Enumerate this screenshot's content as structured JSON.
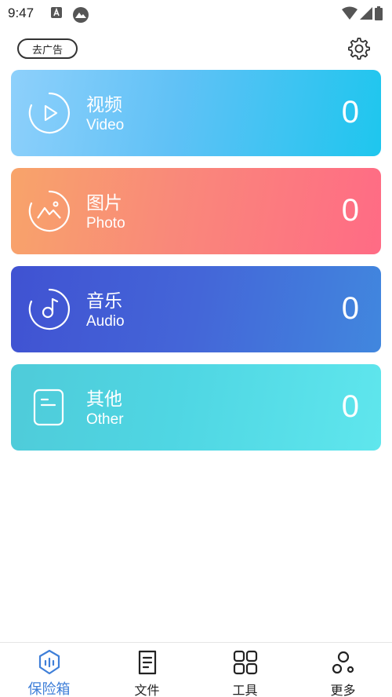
{
  "status_bar": {
    "time": "9:47"
  },
  "header": {
    "ad_button_label": "去广告"
  },
  "categories": [
    {
      "title": "视频",
      "subtitle": "Video",
      "count": "0"
    },
    {
      "title": "图片",
      "subtitle": "Photo",
      "count": "0"
    },
    {
      "title": "音乐",
      "subtitle": "Audio",
      "count": "0"
    },
    {
      "title": "其他",
      "subtitle": "Other",
      "count": "0"
    }
  ],
  "bottom_nav": {
    "items": [
      {
        "label": "保险箱",
        "icon": "vault-icon",
        "active": true
      },
      {
        "label": "文件",
        "icon": "file-icon",
        "active": false
      },
      {
        "label": "工具",
        "icon": "grid-icon",
        "active": false
      },
      {
        "label": "更多",
        "icon": "more-icon",
        "active": false
      }
    ]
  },
  "colors": {
    "active_tab": "#3f7fd8",
    "video_card": "#5fc1f6",
    "photo_card": "#fc7a80",
    "audio_card": "#4462d6",
    "other_card": "#54d8e4"
  }
}
